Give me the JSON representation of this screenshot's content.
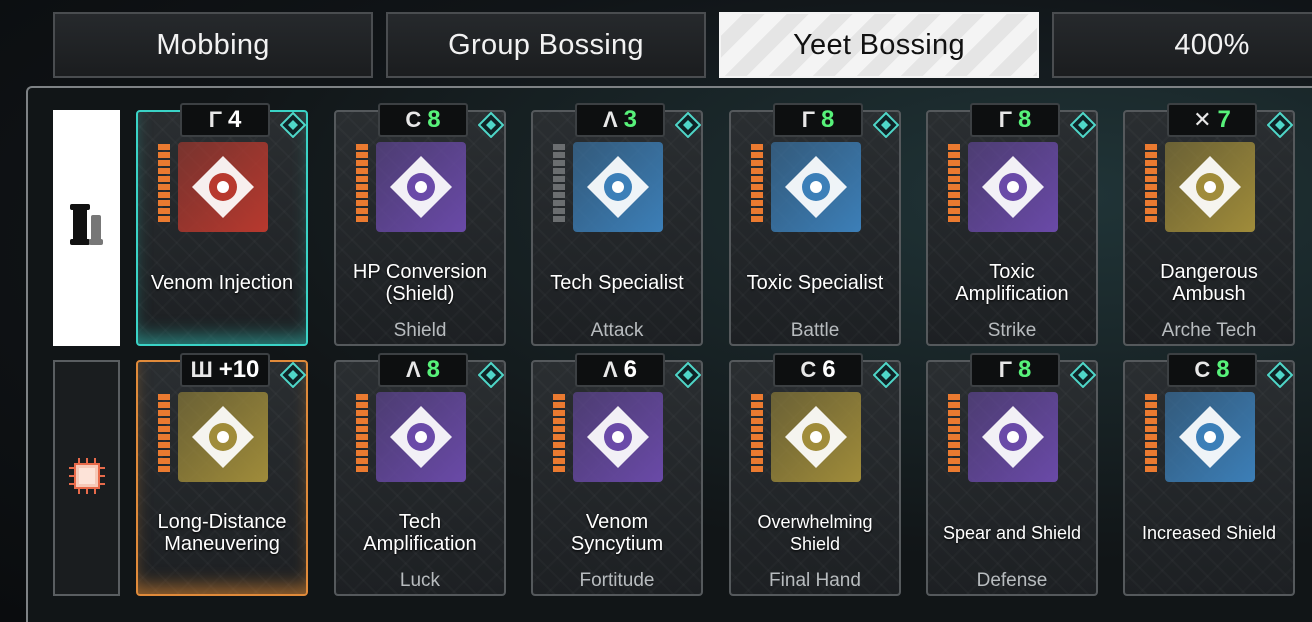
{
  "tabs": [
    {
      "label": "Mobbing"
    },
    {
      "label": "Group Bossing"
    },
    {
      "label": "Yeet Bossing"
    },
    {
      "label": "400%"
    }
  ],
  "colors": {
    "accent_green": "#57f27a",
    "active_tab": "#f4f4f4",
    "teal_select": "#3ad3c6",
    "orange_select": "#e08a3a"
  },
  "row_tabs": [
    {
      "icon": "module-scroll-icon",
      "active": true
    },
    {
      "icon": "chip-icon",
      "active": false
    }
  ],
  "rows": [
    [
      {
        "sym": "Γ",
        "count": "4",
        "name": "Venom Injection",
        "category": "",
        "icon_bg": "#b8392e"
      },
      {
        "sym": "C",
        "count": "8",
        "name": "HP Conversion (Shield)",
        "category": "Shield",
        "icon_bg": "#6a4aa8"
      },
      {
        "sym": "Λ",
        "count": "3",
        "name": "Tech Specialist",
        "category": "Attack",
        "icon_bg": "#3c7fb8"
      },
      {
        "sym": "Γ",
        "count": "8",
        "name": "Toxic Specialist",
        "category": "Battle",
        "icon_bg": "#3c7fb8"
      },
      {
        "sym": "Γ",
        "count": "8",
        "name": "Toxic Amplification",
        "category": "Strike",
        "icon_bg": "#6a4aa8"
      },
      {
        "sym": "✕",
        "count": "7",
        "name": "Dangerous Ambush",
        "category": "Arche Tech",
        "icon_bg": "#a08c3a"
      }
    ],
    [
      {
        "sym": "Ш",
        "count": "+10",
        "name": "Long-Distance Maneuvering",
        "category": "",
        "icon_bg": "#a08c3a"
      },
      {
        "sym": "Λ",
        "count": "8",
        "name": "Tech Amplification",
        "category": "Luck",
        "icon_bg": "#6a4aa8"
      },
      {
        "sym": "Λ",
        "count": "6",
        "name": "Venom Syncytium",
        "category": "Fortitude",
        "icon_bg": "#6a4aa8"
      },
      {
        "sym": "C",
        "count": "6",
        "name": "Overwhelming Shield",
        "category": "Final Hand",
        "icon_bg": "#a08c3a"
      },
      {
        "sym": "Γ",
        "count": "8",
        "name": "Spear and Shield",
        "category": "Defense",
        "icon_bg": "#6a4aa8"
      },
      {
        "sym": "C",
        "count": "8",
        "name": "Increased Shield",
        "category": "",
        "icon_bg": "#3c7fb8"
      }
    ]
  ]
}
